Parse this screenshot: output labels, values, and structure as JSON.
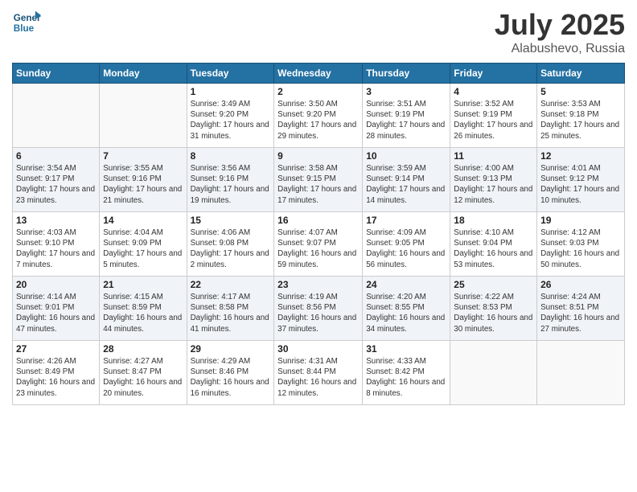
{
  "header": {
    "month_title": "July 2025",
    "location": "Alabushevo, Russia",
    "logo_line1": "General",
    "logo_line2": "Blue"
  },
  "columns": [
    "Sunday",
    "Monday",
    "Tuesday",
    "Wednesday",
    "Thursday",
    "Friday",
    "Saturday"
  ],
  "weeks": [
    [
      {
        "day": "",
        "sunrise": "",
        "sunset": "",
        "daylight": ""
      },
      {
        "day": "",
        "sunrise": "",
        "sunset": "",
        "daylight": ""
      },
      {
        "day": "1",
        "sunrise": "Sunrise: 3:49 AM",
        "sunset": "Sunset: 9:20 PM",
        "daylight": "Daylight: 17 hours and 31 minutes."
      },
      {
        "day": "2",
        "sunrise": "Sunrise: 3:50 AM",
        "sunset": "Sunset: 9:20 PM",
        "daylight": "Daylight: 17 hours and 29 minutes."
      },
      {
        "day": "3",
        "sunrise": "Sunrise: 3:51 AM",
        "sunset": "Sunset: 9:19 PM",
        "daylight": "Daylight: 17 hours and 28 minutes."
      },
      {
        "day": "4",
        "sunrise": "Sunrise: 3:52 AM",
        "sunset": "Sunset: 9:19 PM",
        "daylight": "Daylight: 17 hours and 26 minutes."
      },
      {
        "day": "5",
        "sunrise": "Sunrise: 3:53 AM",
        "sunset": "Sunset: 9:18 PM",
        "daylight": "Daylight: 17 hours and 25 minutes."
      }
    ],
    [
      {
        "day": "6",
        "sunrise": "Sunrise: 3:54 AM",
        "sunset": "Sunset: 9:17 PM",
        "daylight": "Daylight: 17 hours and 23 minutes."
      },
      {
        "day": "7",
        "sunrise": "Sunrise: 3:55 AM",
        "sunset": "Sunset: 9:16 PM",
        "daylight": "Daylight: 17 hours and 21 minutes."
      },
      {
        "day": "8",
        "sunrise": "Sunrise: 3:56 AM",
        "sunset": "Sunset: 9:16 PM",
        "daylight": "Daylight: 17 hours and 19 minutes."
      },
      {
        "day": "9",
        "sunrise": "Sunrise: 3:58 AM",
        "sunset": "Sunset: 9:15 PM",
        "daylight": "Daylight: 17 hours and 17 minutes."
      },
      {
        "day": "10",
        "sunrise": "Sunrise: 3:59 AM",
        "sunset": "Sunset: 9:14 PM",
        "daylight": "Daylight: 17 hours and 14 minutes."
      },
      {
        "day": "11",
        "sunrise": "Sunrise: 4:00 AM",
        "sunset": "Sunset: 9:13 PM",
        "daylight": "Daylight: 17 hours and 12 minutes."
      },
      {
        "day": "12",
        "sunrise": "Sunrise: 4:01 AM",
        "sunset": "Sunset: 9:12 PM",
        "daylight": "Daylight: 17 hours and 10 minutes."
      }
    ],
    [
      {
        "day": "13",
        "sunrise": "Sunrise: 4:03 AM",
        "sunset": "Sunset: 9:10 PM",
        "daylight": "Daylight: 17 hours and 7 minutes."
      },
      {
        "day": "14",
        "sunrise": "Sunrise: 4:04 AM",
        "sunset": "Sunset: 9:09 PM",
        "daylight": "Daylight: 17 hours and 5 minutes."
      },
      {
        "day": "15",
        "sunrise": "Sunrise: 4:06 AM",
        "sunset": "Sunset: 9:08 PM",
        "daylight": "Daylight: 17 hours and 2 minutes."
      },
      {
        "day": "16",
        "sunrise": "Sunrise: 4:07 AM",
        "sunset": "Sunset: 9:07 PM",
        "daylight": "Daylight: 16 hours and 59 minutes."
      },
      {
        "day": "17",
        "sunrise": "Sunrise: 4:09 AM",
        "sunset": "Sunset: 9:05 PM",
        "daylight": "Daylight: 16 hours and 56 minutes."
      },
      {
        "day": "18",
        "sunrise": "Sunrise: 4:10 AM",
        "sunset": "Sunset: 9:04 PM",
        "daylight": "Daylight: 16 hours and 53 minutes."
      },
      {
        "day": "19",
        "sunrise": "Sunrise: 4:12 AM",
        "sunset": "Sunset: 9:03 PM",
        "daylight": "Daylight: 16 hours and 50 minutes."
      }
    ],
    [
      {
        "day": "20",
        "sunrise": "Sunrise: 4:14 AM",
        "sunset": "Sunset: 9:01 PM",
        "daylight": "Daylight: 16 hours and 47 minutes."
      },
      {
        "day": "21",
        "sunrise": "Sunrise: 4:15 AM",
        "sunset": "Sunset: 8:59 PM",
        "daylight": "Daylight: 16 hours and 44 minutes."
      },
      {
        "day": "22",
        "sunrise": "Sunrise: 4:17 AM",
        "sunset": "Sunset: 8:58 PM",
        "daylight": "Daylight: 16 hours and 41 minutes."
      },
      {
        "day": "23",
        "sunrise": "Sunrise: 4:19 AM",
        "sunset": "Sunset: 8:56 PM",
        "daylight": "Daylight: 16 hours and 37 minutes."
      },
      {
        "day": "24",
        "sunrise": "Sunrise: 4:20 AM",
        "sunset": "Sunset: 8:55 PM",
        "daylight": "Daylight: 16 hours and 34 minutes."
      },
      {
        "day": "25",
        "sunrise": "Sunrise: 4:22 AM",
        "sunset": "Sunset: 8:53 PM",
        "daylight": "Daylight: 16 hours and 30 minutes."
      },
      {
        "day": "26",
        "sunrise": "Sunrise: 4:24 AM",
        "sunset": "Sunset: 8:51 PM",
        "daylight": "Daylight: 16 hours and 27 minutes."
      }
    ],
    [
      {
        "day": "27",
        "sunrise": "Sunrise: 4:26 AM",
        "sunset": "Sunset: 8:49 PM",
        "daylight": "Daylight: 16 hours and 23 minutes."
      },
      {
        "day": "28",
        "sunrise": "Sunrise: 4:27 AM",
        "sunset": "Sunset: 8:47 PM",
        "daylight": "Daylight: 16 hours and 20 minutes."
      },
      {
        "day": "29",
        "sunrise": "Sunrise: 4:29 AM",
        "sunset": "Sunset: 8:46 PM",
        "daylight": "Daylight: 16 hours and 16 minutes."
      },
      {
        "day": "30",
        "sunrise": "Sunrise: 4:31 AM",
        "sunset": "Sunset: 8:44 PM",
        "daylight": "Daylight: 16 hours and 12 minutes."
      },
      {
        "day": "31",
        "sunrise": "Sunrise: 4:33 AM",
        "sunset": "Sunset: 8:42 PM",
        "daylight": "Daylight: 16 hours and 8 minutes."
      },
      {
        "day": "",
        "sunrise": "",
        "sunset": "",
        "daylight": ""
      },
      {
        "day": "",
        "sunrise": "",
        "sunset": "",
        "daylight": ""
      }
    ]
  ]
}
